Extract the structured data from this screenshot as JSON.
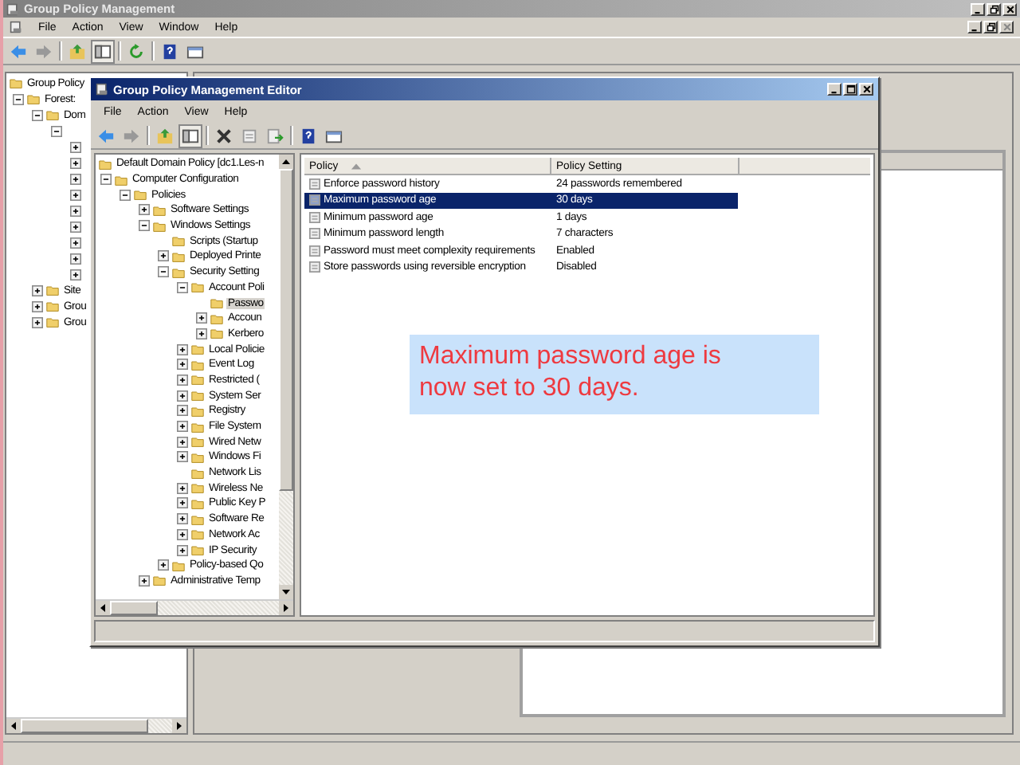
{
  "outer": {
    "title": "Group Policy Management",
    "menu": [
      "File",
      "Action",
      "View",
      "Window",
      "Help"
    ],
    "tree": [
      {
        "label": "Group Policy",
        "kind": "root"
      },
      {
        "label": "Forest:",
        "kind": "node",
        "expanded": true,
        "children": [
          {
            "label": "Dom",
            "kind": "node",
            "expanded": true,
            "children": [
              {
                "kind": "node",
                "expanded": true,
                "children": [
                  {
                    "kind": "node",
                    "expanded": false
                  },
                  {
                    "kind": "node",
                    "expanded": false
                  },
                  {
                    "kind": "node",
                    "expanded": false
                  },
                  {
                    "kind": "node",
                    "expanded": false
                  },
                  {
                    "kind": "node",
                    "expanded": false
                  },
                  {
                    "kind": "node",
                    "expanded": false
                  },
                  {
                    "kind": "node",
                    "expanded": false
                  },
                  {
                    "kind": "node",
                    "expanded": false
                  },
                  {
                    "kind": "node",
                    "expanded": false
                  }
                ]
              }
            ]
          },
          {
            "label": "Site",
            "kind": "node",
            "expanded": false
          },
          {
            "label": "Grou",
            "kind": "node",
            "expanded": false
          },
          {
            "label": "Grou",
            "kind": "node",
            "expanded": false
          }
        ]
      }
    ]
  },
  "editor": {
    "title": "Group Policy Management Editor",
    "menu": [
      "File",
      "Action",
      "View",
      "Help"
    ],
    "tree": [
      {
        "label": "Default Domain Policy [dc1.Les-n",
        "kind": "root",
        "selected": false
      },
      {
        "label": "Computer Configuration",
        "kind": "node",
        "expanded": true,
        "selected": false,
        "children": [
          {
            "label": "Policies",
            "kind": "node",
            "expanded": true,
            "selected": false,
            "children": [
              {
                "label": "Software Settings",
                "kind": "node",
                "expanded": false,
                "selected": false
              },
              {
                "label": "Windows Settings",
                "kind": "node",
                "expanded": true,
                "selected": false,
                "children": [
                  {
                    "label": "Scripts (Startup",
                    "kind": "leaf",
                    "selected": false
                  },
                  {
                    "label": "Deployed Printe",
                    "kind": "node",
                    "expanded": false,
                    "selected": false
                  },
                  {
                    "label": "Security Setting",
                    "kind": "node",
                    "expanded": true,
                    "selected": false,
                    "children": [
                      {
                        "label": "Account Poli",
                        "kind": "node",
                        "expanded": true,
                        "selected": false,
                        "children": [
                          {
                            "label": "Passwo",
                            "kind": "leaf",
                            "selected": true
                          },
                          {
                            "label": "Accoun",
                            "kind": "node",
                            "expanded": false,
                            "selected": false
                          },
                          {
                            "label": "Kerbero",
                            "kind": "node",
                            "expanded": false,
                            "selected": false
                          }
                        ]
                      },
                      {
                        "label": "Local Policie",
                        "kind": "node",
                        "expanded": false,
                        "selected": false
                      },
                      {
                        "label": "Event Log",
                        "kind": "node",
                        "expanded": false,
                        "selected": false
                      },
                      {
                        "label": "Restricted (",
                        "kind": "node",
                        "expanded": false,
                        "selected": false
                      },
                      {
                        "label": "System Ser",
                        "kind": "node",
                        "expanded": false,
                        "selected": false
                      },
                      {
                        "label": "Registry",
                        "kind": "node",
                        "expanded": false,
                        "selected": false
                      },
                      {
                        "label": "File System",
                        "kind": "node",
                        "expanded": false,
                        "selected": false
                      },
                      {
                        "label": "Wired Netw",
                        "kind": "node",
                        "expanded": false,
                        "selected": false
                      },
                      {
                        "label": "Windows Fi",
                        "kind": "node",
                        "expanded": false,
                        "selected": false
                      },
                      {
                        "label": "Network Lis",
                        "kind": "leaf",
                        "selected": false
                      },
                      {
                        "label": "Wireless Ne",
                        "kind": "node",
                        "expanded": false,
                        "selected": false
                      },
                      {
                        "label": "Public Key P",
                        "kind": "node",
                        "expanded": false,
                        "selected": false
                      },
                      {
                        "label": "Software Re",
                        "kind": "node",
                        "expanded": false,
                        "selected": false
                      },
                      {
                        "label": "Network Ac",
                        "kind": "node",
                        "expanded": false,
                        "selected": false
                      },
                      {
                        "label": "IP Security",
                        "kind": "node",
                        "expanded": false,
                        "selected": false
                      }
                    ]
                  },
                  {
                    "label": "Policy-based Qo",
                    "kind": "node",
                    "expanded": false,
                    "selected": false
                  }
                ]
              },
              {
                "label": "Administrative Temp",
                "kind": "node",
                "expanded": false,
                "selected": false
              }
            ]
          }
        ]
      }
    ],
    "columns": [
      "Policy",
      "Policy Setting"
    ],
    "rows": [
      {
        "policy": "Enforce password history",
        "setting": "24 passwords remembered",
        "selected": false
      },
      {
        "policy": "Maximum password age",
        "setting": "30 days",
        "selected": true
      },
      {
        "policy": "Minimum password age",
        "setting": "1 days",
        "selected": false
      },
      {
        "policy": "Minimum password length",
        "setting": "7 characters",
        "selected": false
      },
      {
        "policy": "Password must meet complexity requirements",
        "setting": "Enabled",
        "selected": false
      },
      {
        "policy": "Store passwords using reversible encryption",
        "setting": "Disabled",
        "selected": false
      }
    ]
  },
  "note": "Maximum password age is now set to 30 days."
}
